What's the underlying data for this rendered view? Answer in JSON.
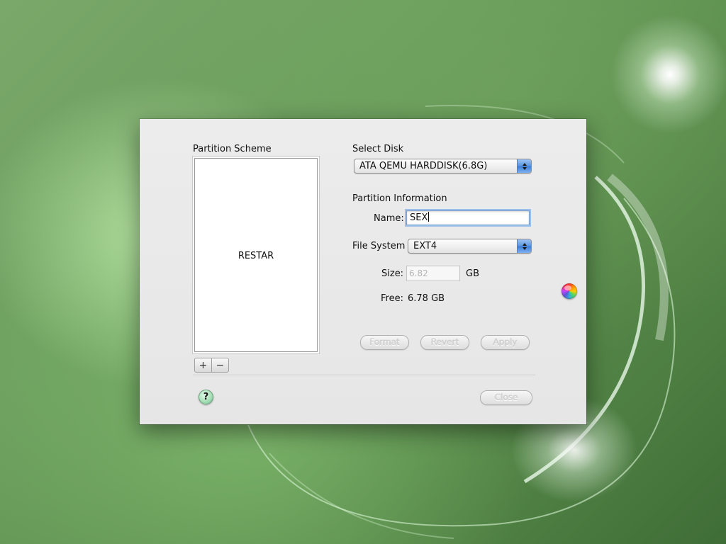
{
  "dialog": {
    "partition_scheme": {
      "label": "Partition Scheme",
      "selected_item": "RESTAR",
      "add_button": "+",
      "remove_button": "−"
    },
    "select_disk": {
      "label": "Select Disk",
      "value": "ATA QEMU HARDDISK(6.8G)"
    },
    "partition_information": {
      "label": "Partition Information",
      "name_label": "Name:",
      "name_value": "SEX",
      "filesystem_label": "File System",
      "filesystem_value": "EXT4",
      "size_label": "Size:",
      "size_value": "6.82",
      "size_unit": "GB",
      "free_label": "Free:",
      "free_value": "6.78 GB"
    },
    "buttons": {
      "format": "Format",
      "revert": "Revert",
      "apply": "Apply",
      "close": "Close",
      "help": "?"
    }
  },
  "desktop": {
    "color_wheel_icon": "color-wheel-icon"
  },
  "colors": {
    "window_bg": "#ececec",
    "popup_accent": "#5a94e0",
    "focus_ring": "#9cc0ea",
    "help_button": "#a8e0b8",
    "desktop_green": "#5e9050"
  }
}
